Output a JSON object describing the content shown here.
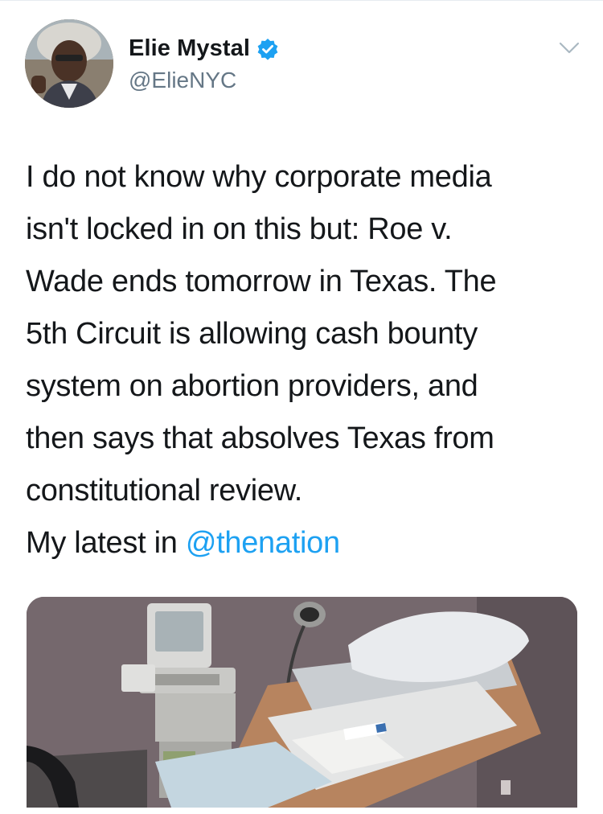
{
  "tweet": {
    "author": {
      "display_name": "Elie Mystal",
      "handle": "@ElieNYC",
      "verified": true,
      "avatar": "profile-photo"
    },
    "menu_icon": "chevron-down-icon",
    "text_lines": [
      "I do not know why corporate media",
      "isn't locked in on this but: Roe v.",
      "Wade ends tomorrow in Texas. The",
      "5th Circuit is allowing cash bounty",
      "system on abortion providers, and",
      "then says that absolves Texas from",
      "constitutional review."
    ],
    "last_line_prefix": "My latest in ",
    "mention": "@thenation",
    "media": {
      "type": "photo",
      "description_icon": "exam-room-photo"
    }
  },
  "colors": {
    "text": "#14171a",
    "secondary": "#657786",
    "link": "#1da1f2",
    "verified": "#1da1f2"
  }
}
